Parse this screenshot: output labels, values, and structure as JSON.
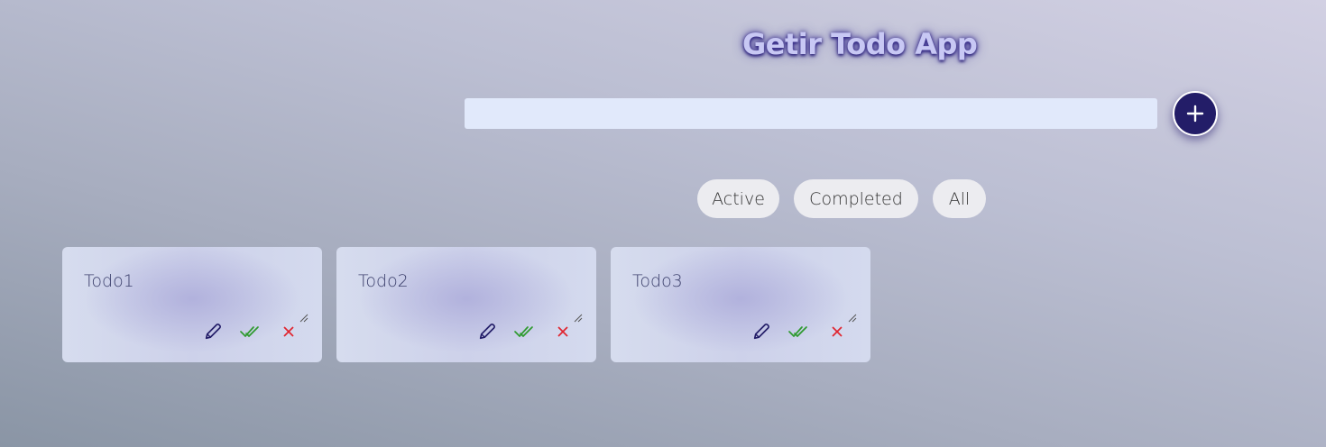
{
  "app": {
    "title": "Getir Todo App"
  },
  "input": {
    "value": "",
    "placeholder": ""
  },
  "filters": [
    {
      "label": "Active"
    },
    {
      "label": "Completed"
    },
    {
      "label": "All"
    }
  ],
  "todos": [
    {
      "text": "Todo1"
    },
    {
      "text": "Todo2"
    },
    {
      "text": "Todo3"
    }
  ],
  "icons": {
    "add": "plus-icon",
    "edit": "pencil-icon",
    "complete": "double-check-icon",
    "delete": "close-icon"
  },
  "colors": {
    "accent": "#231d68",
    "title_text": "#c8c8f4",
    "input_bg": "#e1e9fb",
    "edit_icon": "#231d68",
    "complete_icon": "#2e9a2e",
    "delete_icon": "#e0242e"
  }
}
